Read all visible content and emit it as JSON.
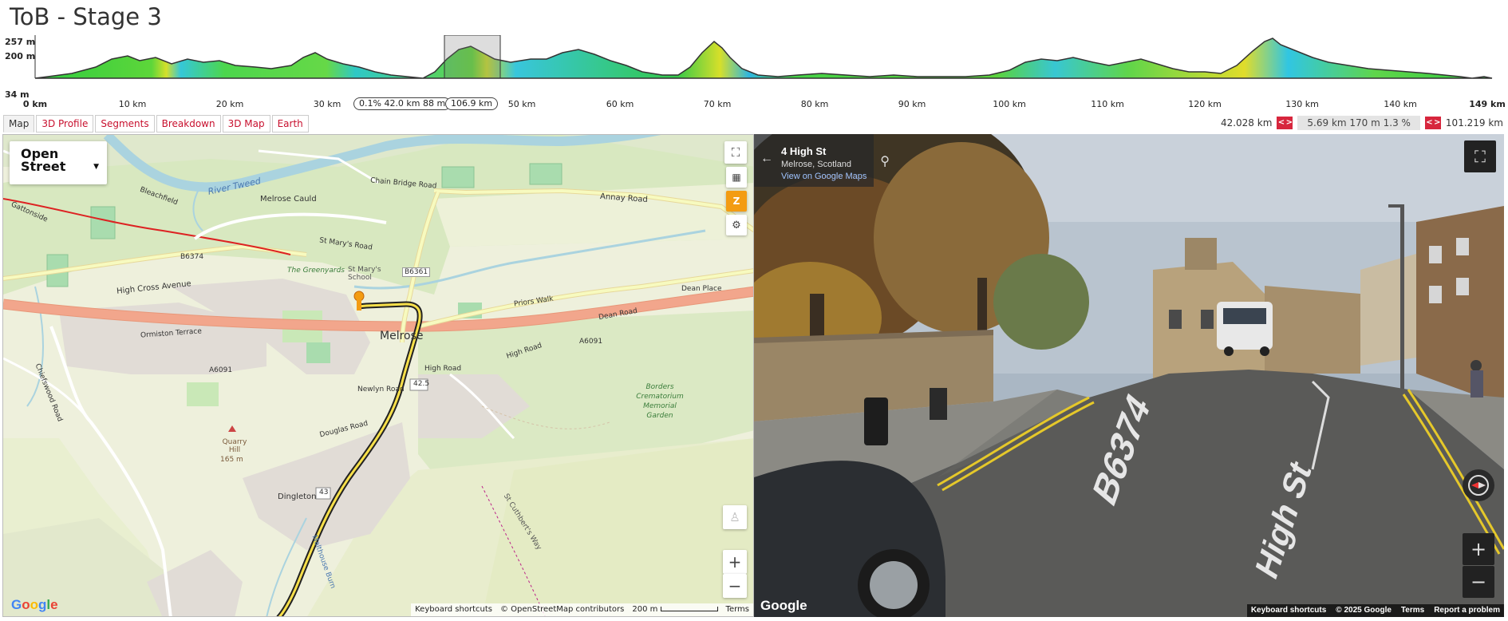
{
  "title": "ToB - Stage 3",
  "profile": {
    "y_labels": [
      "257 m",
      "200 m",
      "34 m"
    ],
    "x_labels": [
      "0 km",
      "10 km",
      "20 km",
      "30 km",
      "50 km",
      "60 km",
      "70 km",
      "80 km",
      "90 km",
      "100 km",
      "110 km",
      "120 km",
      "130 km",
      "140 km",
      "149 km"
    ],
    "cursor_info": "0.1% 42.0 km 88 m",
    "cursor_end": "106.9 km"
  },
  "tabs": [
    "Map",
    "3D Profile",
    "Segments",
    "Breakdown",
    "3D Map",
    "Earth"
  ],
  "segment": {
    "start": "42.028 km",
    "prev_label": "< >",
    "stats": "5.69 km 170 m 1.3 %",
    "next_label": "< >",
    "end": "101.219 km"
  },
  "map": {
    "layer": "Open Street",
    "labels": {
      "river": "River Tweed",
      "cauld": "Melrose Cauld",
      "chain": "Chain Bridge Road",
      "annay": "Annay Road",
      "stmarys_rd": "St Mary's Road",
      "greenyards": "The Greenyards",
      "stmarys_school": "St Mary's School",
      "b6361": "B6361",
      "b6374": "B6374",
      "highcross": "High Cross Avenue",
      "melrose": "Melrose",
      "ormiston": "Ormiston Terrace",
      "a6091_left": "A6091",
      "a6091_right": "A6091",
      "highroad1": "High Road",
      "highroad2": "High Road",
      "deanroad": "Dean Road",
      "deanplace": "Dean Place",
      "priors": "Priors Walk",
      "newlyn": "Newlyn Road",
      "douglas": "Douglas Road",
      "quarry": "Quarry Hill",
      "quarry_h": "165 m",
      "borders": "Borders Crematorium Memorial Garden",
      "chiefswood": "Chiefswood Road",
      "dingleton": "Dingleton",
      "malthouse": "Malthouse Burn",
      "stcuthberts": "St Cuthbert's Way",
      "km42": "42.5",
      "km43": "43",
      "bleachfield": "Bleachfield",
      "gattonside": "Gattonside"
    },
    "attribution": {
      "shortcuts": "Keyboard shortcuts",
      "osm": "© OpenStreetMap contributors",
      "scale": "200 m",
      "terms": "Terms"
    },
    "google_logo": "Google",
    "zoom_in": "+",
    "zoom_out": "−"
  },
  "streetview": {
    "address": "4 High St",
    "place": "Melrose, Scotland",
    "link": "View on Google Maps",
    "road1": "B6374",
    "road2": "High St",
    "attribution": {
      "shortcuts": "Keyboard shortcuts",
      "copy": "© 2025 Google",
      "terms": "Terms",
      "report": "Report a problem"
    },
    "google_logo": "Google",
    "zoom_in": "+",
    "zoom_out": "−"
  }
}
